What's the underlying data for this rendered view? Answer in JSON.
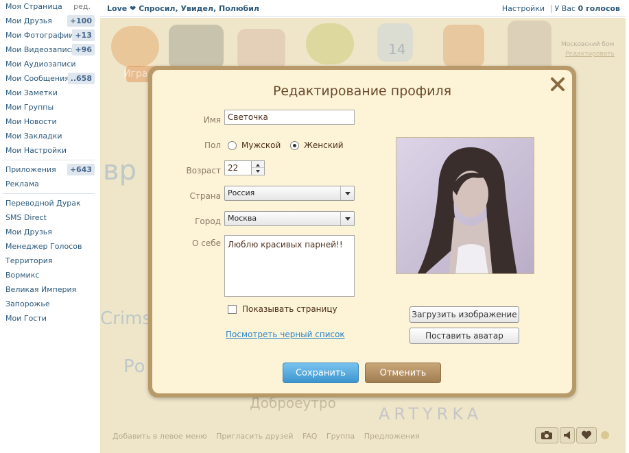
{
  "sidebar": {
    "edit_label": "ред.",
    "items": [
      {
        "label": "Моя Страница",
        "count": ""
      },
      {
        "label": "Мои Друзья",
        "count": "+100"
      },
      {
        "label": "Мои Фотографии",
        "count": "+13"
      },
      {
        "label": "Мои Видеозаписи",
        "count": "+96"
      },
      {
        "label": "Мои Аудиозаписи",
        "count": ""
      },
      {
        "label": "Мои Сообщения",
        "count": "..658"
      },
      {
        "label": "Мои Заметки",
        "count": ""
      },
      {
        "label": "Мои Группы",
        "count": ""
      },
      {
        "label": "Мои Новости",
        "count": ""
      },
      {
        "label": "Мои Закладки",
        "count": ""
      },
      {
        "label": "Мои Настройки",
        "count": ""
      }
    ],
    "items2": [
      {
        "label": "Приложения",
        "count": "+643"
      },
      {
        "label": "Реклама",
        "count": ""
      }
    ],
    "apps": [
      "Переводной Дурак",
      "SMS Direct",
      "Мои Друзья",
      "Менеджер Голосов",
      "Территория",
      "Вормикс",
      "Великая Империя",
      "Запорожье",
      "Мои Гости"
    ]
  },
  "header": {
    "app_title": "Love ❤ Спросил, Увидел, Полюбил",
    "settings": "Настройки",
    "votes_prefix": "У Вас",
    "votes_value": "0 голосов"
  },
  "background": {
    "play": "Игра",
    "city": "Московский бом",
    "edit": "Редактировать",
    "footer": [
      "Добавить в левое меню",
      "Пригласить друзей",
      "FAQ",
      "Группа",
      "Предложения"
    ],
    "morning": "Доброеутро",
    "artyrka": "ARTYRKA",
    "calendar_day": "14"
  },
  "modal": {
    "title": "Редактирование профиля",
    "name_label": "Имя",
    "name_value": "Светочка",
    "gender_label": "Пол",
    "gender_male": "Мужской",
    "gender_female": "Женский",
    "gender_selected": "Женский",
    "age_label": "Возраст",
    "age_value": "22",
    "country_label": "Страна",
    "country_value": "Россия",
    "city_label": "Город",
    "city_value": "Москва",
    "about_label": "О себе",
    "about_value": "Люблю красивых парней!!",
    "show_page_label": "Показывать страницу",
    "show_page_checked": false,
    "blacklist_link": "Посмотреть черный список",
    "upload_button": "Загрузить изображение",
    "avatar_button": "Поставить аватар",
    "save_button": "Сохранить",
    "cancel_button": "Отменить"
  },
  "colors": {
    "accent_blue": "#3d95cf",
    "modal_frame": "#b89a6a",
    "modal_bg": "#fdf3d6",
    "link": "#2a86c9"
  }
}
